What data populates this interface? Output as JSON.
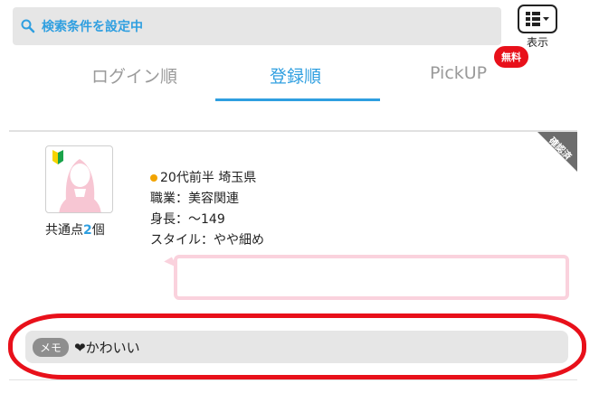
{
  "search": {
    "label": "検索条件を設定中",
    "icon": "search-settings-icon"
  },
  "view_toggle": {
    "caption": "表示",
    "icon": "list-view-icon"
  },
  "tabs": [
    {
      "label": "ログイン順",
      "active": false
    },
    {
      "label": "登録順",
      "active": true
    },
    {
      "label": "PickUP",
      "active": false
    }
  ],
  "free_badge": "無料",
  "colors": {
    "accent": "#2f9fe0",
    "badge": "#e8101a",
    "dot": "#f2a400",
    "bubble_border": "#fad2dd"
  },
  "profile": {
    "verified_label": "確認済",
    "common_label": "共通点",
    "common_count": "2",
    "common_unit": "個",
    "age_area": "20代前半 埼玉県",
    "occupation": "職業：美容関連",
    "height": "身長：～149",
    "style": "スタイル：やや細め",
    "bubble_text": ""
  },
  "memo": {
    "tag": "メモ",
    "text": "❤かわいい"
  }
}
